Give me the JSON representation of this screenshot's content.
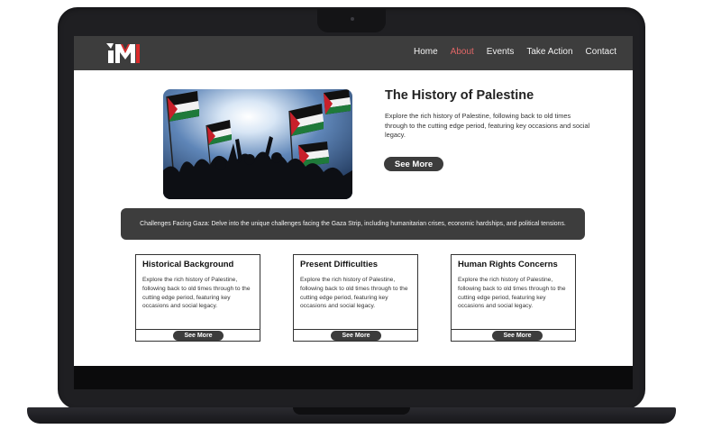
{
  "nav": {
    "logo_text": "IM",
    "links": [
      "Home",
      "About",
      "Events",
      "Take Action",
      "Contact"
    ],
    "active_link": "About",
    "active_color": "#e06666"
  },
  "hero": {
    "title": "The History of Palestine",
    "description": "Explore the rich history of Palestine, following back to old times through to the cutting edge period, featuring key occasions and social legacy.",
    "button_label": "See More",
    "image": "protest-flags-photo"
  },
  "banner": {
    "text": "Challenges Facing Gaza: Delve into the unique challenges facing the Gaza Strip, including humanitarian crises, economic hardships, and political tensions."
  },
  "cards": [
    {
      "title": "Historical Background",
      "description": "Explore the rich history of Palestine, following back to old times through to the cutting edge period, featuring key occasions and social legacy.",
      "button_label": "See More"
    },
    {
      "title": "Present Difficulties",
      "description": "Explore the rich history of Palestine, following back to old times through to the cutting edge period, featuring key occasions and social legacy.",
      "button_label": "See More"
    },
    {
      "title": "Human Rights Concerns",
      "description": "Explore the rich history of Palestine, following back to old times through to the cutting edge period, featuring key occasions and social legacy.",
      "button_label": "See More"
    }
  ],
  "colors": {
    "navbar": "#3d3d3d",
    "button": "#3c3c3c",
    "logo_red": "#d92b2b"
  }
}
